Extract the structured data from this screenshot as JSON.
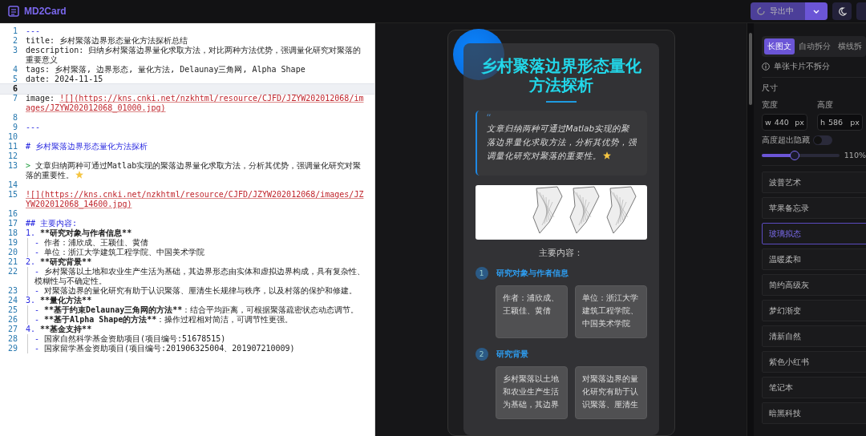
{
  "app": {
    "title": "MD2Card"
  },
  "editor": {
    "lines": [
      {
        "num": "1",
        "indented": false,
        "current": false,
        "segments": [
          {
            "kind": "marker",
            "text": "---"
          }
        ]
      },
      {
        "num": "2",
        "indented": false,
        "current": false,
        "segments": [
          {
            "kind": "plain",
            "text": "title: 乡村聚落边界形态量化方法探析总结"
          }
        ]
      },
      {
        "num": "3",
        "indented": false,
        "current": false,
        "segments": [
          {
            "kind": "plain",
            "text": "description: 归纳乡村聚落边界量化求取方法，对比两种方法优势，强调量化研究对聚落的重要意义"
          }
        ]
      },
      {
        "num": "4",
        "indented": false,
        "current": false,
        "segments": [
          {
            "kind": "plain",
            "text": "tags: 乡村聚落, 边界形态, 量化方法, Delaunay三角网, Alpha Shape"
          }
        ]
      },
      {
        "num": "5",
        "indented": false,
        "current": false,
        "segments": [
          {
            "kind": "plain",
            "text": "date: 2024-11-15"
          }
        ]
      },
      {
        "num": "6",
        "current": true
      },
      {
        "num": "7",
        "indented": false,
        "current": false,
        "segments": [
          {
            "kind": "plain",
            "text": "image: "
          },
          {
            "kind": "link",
            "text": "![](https://kns.cnki.net/nzkhtml/resource/CJFD/JZYW202012068/images/JZYW202012068_01000.jpg)"
          }
        ]
      },
      {
        "num": "8",
        "current": false
      },
      {
        "num": "9",
        "indented": false,
        "current": false,
        "segments": [
          {
            "kind": "marker",
            "text": "---"
          }
        ]
      },
      {
        "num": "10",
        "current": false
      },
      {
        "num": "11",
        "indented": false,
        "current": false,
        "segments": [
          {
            "kind": "heading",
            "text": "# 乡村聚落边界形态量化方法探析"
          }
        ]
      },
      {
        "num": "12",
        "current": false
      },
      {
        "num": "13",
        "indented": false,
        "current": false,
        "star": true,
        "segments": [
          {
            "kind": "quote",
            "text": ">"
          },
          {
            "kind": "plain",
            "text": " 文章归纳两种可通过Matlab实现的聚落边界量化求取方法，分析其优势，强调量化研究对聚落的重要性。"
          }
        ]
      },
      {
        "num": "14",
        "current": false
      },
      {
        "num": "15",
        "indented": false,
        "current": false,
        "segments": [
          {
            "kind": "link",
            "text": "![](https://kns.cnki.net/nzkhtml/resource/CJFD/JZYW202012068/images/JZYW202012068_14600.jpg)"
          }
        ]
      },
      {
        "num": "16",
        "current": false
      },
      {
        "num": "17",
        "indented": false,
        "current": false,
        "segments": [
          {
            "kind": "heading",
            "text": "## 主要内容:"
          }
        ]
      },
      {
        "num": "18",
        "indented": false,
        "current": false,
        "segments": [
          {
            "kind": "marker",
            "text": "1."
          },
          {
            "kind": "bold",
            "text": " **研究对象与作者信息**"
          }
        ]
      },
      {
        "num": "19",
        "indented": true,
        "current": false,
        "segments": [
          {
            "kind": "marker",
            "text": "-"
          },
          {
            "kind": "plain",
            "text": " 作者：浦欣成、王颖佳、黄倩"
          }
        ]
      },
      {
        "num": "20",
        "indented": true,
        "current": false,
        "segments": [
          {
            "kind": "marker",
            "text": "-"
          },
          {
            "kind": "plain",
            "text": " 单位：浙江大学建筑工程学院、中国美术学院"
          }
        ]
      },
      {
        "num": "21",
        "indented": false,
        "current": false,
        "segments": [
          {
            "kind": "marker",
            "text": "2."
          },
          {
            "kind": "bold",
            "text": " **研究背景**"
          }
        ]
      },
      {
        "num": "22",
        "indented": true,
        "current": false,
        "segments": [
          {
            "kind": "marker",
            "text": "-"
          },
          {
            "kind": "plain",
            "text": " 乡村聚落以土地和农业生产生活为基础，其边界形态由实体和虚拟边界构成，具有复杂性、模糊性与不确定性。"
          }
        ]
      },
      {
        "num": "23",
        "indented": true,
        "current": false,
        "segments": [
          {
            "kind": "marker",
            "text": "-"
          },
          {
            "kind": "plain",
            "text": " 对聚落边界的量化研究有助于认识聚落、厘清生长规律与秩序，以及村落的保护和修建。"
          }
        ]
      },
      {
        "num": "24",
        "indented": false,
        "current": false,
        "segments": [
          {
            "kind": "marker",
            "text": "3."
          },
          {
            "kind": "bold",
            "text": " **量化方法**"
          }
        ]
      },
      {
        "num": "25",
        "indented": true,
        "current": false,
        "segments": [
          {
            "kind": "marker",
            "text": "-"
          },
          {
            "kind": "bold",
            "text": " **基于约束Delaunay三角网的方法**"
          },
          {
            "kind": "plain",
            "text": "：结合平均距离，可根据聚落疏密状态动态调节。"
          }
        ]
      },
      {
        "num": "26",
        "indented": true,
        "current": false,
        "segments": [
          {
            "kind": "marker",
            "text": "-"
          },
          {
            "kind": "bold",
            "text": " **基于Alpha Shape的方法**"
          },
          {
            "kind": "plain",
            "text": "：操作过程相对简洁，可调节性更强。"
          }
        ]
      },
      {
        "num": "27",
        "indented": false,
        "current": false,
        "segments": [
          {
            "kind": "marker",
            "text": "4."
          },
          {
            "kind": "bold",
            "text": " **基金支持**"
          }
        ]
      },
      {
        "num": "28",
        "indented": true,
        "current": false,
        "segments": [
          {
            "kind": "marker",
            "text": "-"
          },
          {
            "kind": "plain",
            "text": " 国家自然科学基金资助项目(项目编号:51678515)"
          }
        ]
      },
      {
        "num": "29",
        "indented": true,
        "current": false,
        "segments": [
          {
            "kind": "marker",
            "text": "-"
          },
          {
            "kind": "plain",
            "text": " 国家留学基金资助项目(项目编号:201906325004、201907210009)"
          }
        ]
      }
    ]
  },
  "preview": {
    "title": "乡村聚落边界形态量化方法探析",
    "quote": {
      "mark": "“",
      "text": "文章归纳两种可通过Matlab实现的聚落边界量化求取方法，分析其优势，强调量化研究对聚落的重要性。",
      "star": true
    },
    "section_heading": "主要内容：",
    "sections": [
      {
        "number": "1",
        "title": "研究对象与作者信息",
        "cards": [
          "作者：浦欣成、王颖佳、黄倩",
          "单位：浙江大学建筑工程学院、中国美术学院"
        ]
      },
      {
        "number": "2",
        "title": "研究背景",
        "cards": [
          "乡村聚落以土地和农业生产生活为基础，其边界",
          "对聚落边界的量化研究有助于认识聚落、厘清生"
        ]
      }
    ]
  },
  "toolbar": {
    "export_button": "导出中"
  },
  "settings": {
    "tabs": [
      {
        "label": "长图文",
        "selected": true
      },
      {
        "label": "自动拆分",
        "selected": false
      },
      {
        "label": "横线拆",
        "selected": false
      }
    ],
    "info": "单张卡片不拆分",
    "size_label": "尺寸",
    "width": {
      "label": "宽度",
      "prefix": "w",
      "value": "440",
      "unit": "px"
    },
    "height": {
      "label": "高度",
      "prefix": "h",
      "value": "586",
      "unit": "px"
    },
    "overflow_toggle": {
      "label": "高度超出隐藏",
      "on": false
    },
    "zoom": {
      "level": 0.42,
      "reading": "110%"
    },
    "themes": [
      {
        "label": "波普艺术",
        "selected": false
      },
      {
        "label": "苹果备忘录",
        "selected": false
      },
      {
        "label": "玻璃拟态",
        "selected": true
      },
      {
        "label": "温暖柔和",
        "selected": false
      },
      {
        "label": "简约高级灰",
        "selected": false
      },
      {
        "label": "梦幻渐变",
        "selected": false
      },
      {
        "label": "清新自然",
        "selected": false
      },
      {
        "label": "紫色小红书",
        "selected": false
      },
      {
        "label": "笔记本",
        "selected": false
      },
      {
        "label": "暗黑科技",
        "selected": false
      }
    ]
  }
}
